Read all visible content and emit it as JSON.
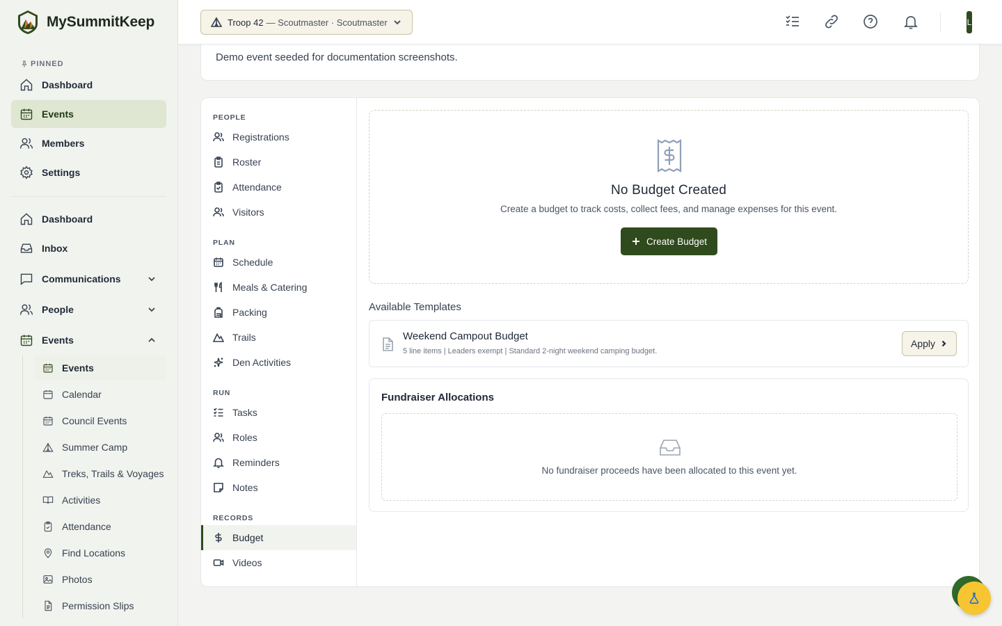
{
  "brand": {
    "name": "MySummitKeep"
  },
  "sidebar": {
    "pinned_label": "PINNED",
    "pinned": [
      {
        "label": "Dashboard",
        "icon": "home-icon"
      },
      {
        "label": "Events",
        "icon": "calendar-icon"
      },
      {
        "label": "Members",
        "icon": "users-icon"
      },
      {
        "label": "Settings",
        "icon": "gear-icon"
      }
    ],
    "main": [
      {
        "label": "Dashboard",
        "icon": "home-icon"
      },
      {
        "label": "Inbox",
        "icon": "inbox-icon"
      },
      {
        "label": "Communications",
        "icon": "message-icon"
      },
      {
        "label": "People",
        "icon": "users-icon"
      },
      {
        "label": "Events",
        "icon": "calendar-icon"
      }
    ],
    "events_sub": [
      {
        "label": "Events"
      },
      {
        "label": "Calendar"
      },
      {
        "label": "Council Events"
      },
      {
        "label": "Summer Camp"
      },
      {
        "label": "Treks, Trails & Voyages"
      },
      {
        "label": "Activities"
      },
      {
        "label": "Attendance"
      },
      {
        "label": "Find Locations"
      },
      {
        "label": "Photos"
      },
      {
        "label": "Permission Slips"
      }
    ]
  },
  "header": {
    "troop_name": "Troop 42",
    "troop_role": "— Scoutmaster · Scoutmaster",
    "avatar_initial": "L"
  },
  "event": {
    "description": "Demo event seeded for documentation screenshots."
  },
  "subnav": {
    "sections": [
      {
        "label": "PEOPLE",
        "items": [
          "Registrations",
          "Roster",
          "Attendance",
          "Visitors"
        ]
      },
      {
        "label": "PLAN",
        "items": [
          "Schedule",
          "Meals & Catering",
          "Packing",
          "Trails",
          "Den Activities"
        ]
      },
      {
        "label": "RUN",
        "items": [
          "Tasks",
          "Roles",
          "Reminders",
          "Notes"
        ]
      },
      {
        "label": "RECORDS",
        "items": [
          "Budget",
          "Videos"
        ]
      }
    ],
    "active": "Budget"
  },
  "budget": {
    "empty_title": "No Budget Created",
    "empty_desc": "Create a budget to track costs, collect fees, and manage expenses for this event.",
    "create_label": "Create Budget",
    "templates_heading": "Available Templates",
    "template": {
      "name": "Weekend Campout Budget",
      "meta": "5 line items | Leaders exempt | Standard 2-night weekend camping budget.",
      "apply_label": "Apply"
    },
    "fundraiser_title": "Fundraiser Allocations",
    "fundraiser_empty": "No fundraiser proceeds have been allocated to this event yet."
  },
  "colors": {
    "accent": "#2f4a1c",
    "active_bg": "#dfe6d2",
    "fab": "#f6c531"
  }
}
